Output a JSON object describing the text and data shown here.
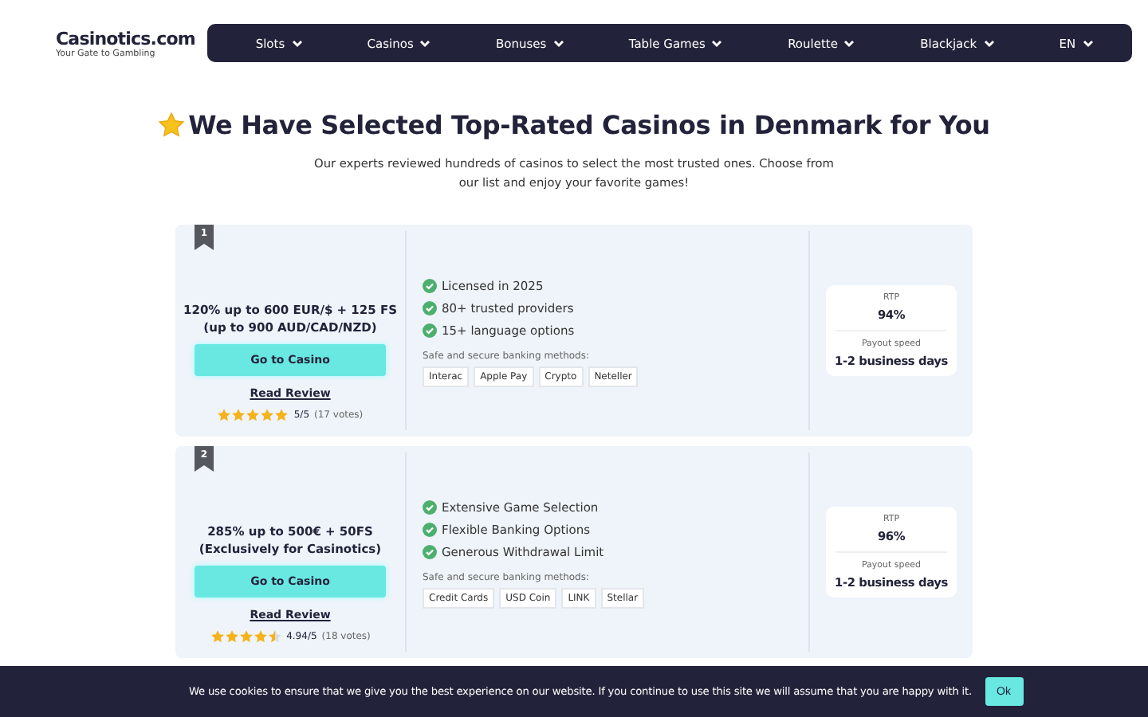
{
  "logo": {
    "name": "Casinotics.com",
    "tagline": "Your Gate to Gambling"
  },
  "nav": [
    {
      "label": "Slots"
    },
    {
      "label": "Casinos"
    },
    {
      "label": "Bonuses"
    },
    {
      "label": "Table Games"
    },
    {
      "label": "Roulette"
    },
    {
      "label": "Blackjack"
    },
    {
      "label": "EN"
    }
  ],
  "heading": "We Have Selected Top-Rated Casinos in Denmark for You",
  "intro": "Our experts reviewed hundreds of casinos to select the most trusted ones. Choose from our list and enjoy your favorite games!",
  "casinos": [
    {
      "rank": "1",
      "bonus": "120% up to 600 EUR/$ + 125 FS (up to 900 AUD/CAD/NZD)",
      "cta": "Go to Casino",
      "review": "Read Review",
      "stars": 5,
      "rating": "5/5",
      "votes": "(17 votes)",
      "features": [
        "Licensed in 2025",
        "80+ trusted providers",
        "15+ language options"
      ],
      "banking_label": "Safe and secure banking methods:",
      "banking": [
        "Interac",
        "Apple Pay",
        "Crypto",
        "Neteller"
      ],
      "rtp_label": "RTP",
      "rtp": "94%",
      "payout_label": "Payout speed",
      "payout": "1-2 business days"
    },
    {
      "rank": "2",
      "bonus": "285% up to 500€ + 50FS (Exclusively for Casinotics)",
      "cta": "Go to Casino",
      "review": "Read Review",
      "stars": 4.5,
      "rating": "4.94/5",
      "votes": "(18 votes)",
      "features": [
        "Extensive Game Selection",
        "Flexible Banking Options",
        "Generous Withdrawal Limit"
      ],
      "banking_label": "Safe and secure banking methods:",
      "banking": [
        "Credit Cards",
        "USD Coin",
        "LINK",
        "Stellar"
      ],
      "rtp_label": "RTP",
      "rtp": "96%",
      "payout_label": "Payout speed",
      "payout": "1-2 business days"
    }
  ],
  "cookie_bar": {
    "message": "We use cookies to ensure that we give you the best experience on our website. If you continue to use this site we will assume that you are happy with it.",
    "button": "Ok"
  }
}
